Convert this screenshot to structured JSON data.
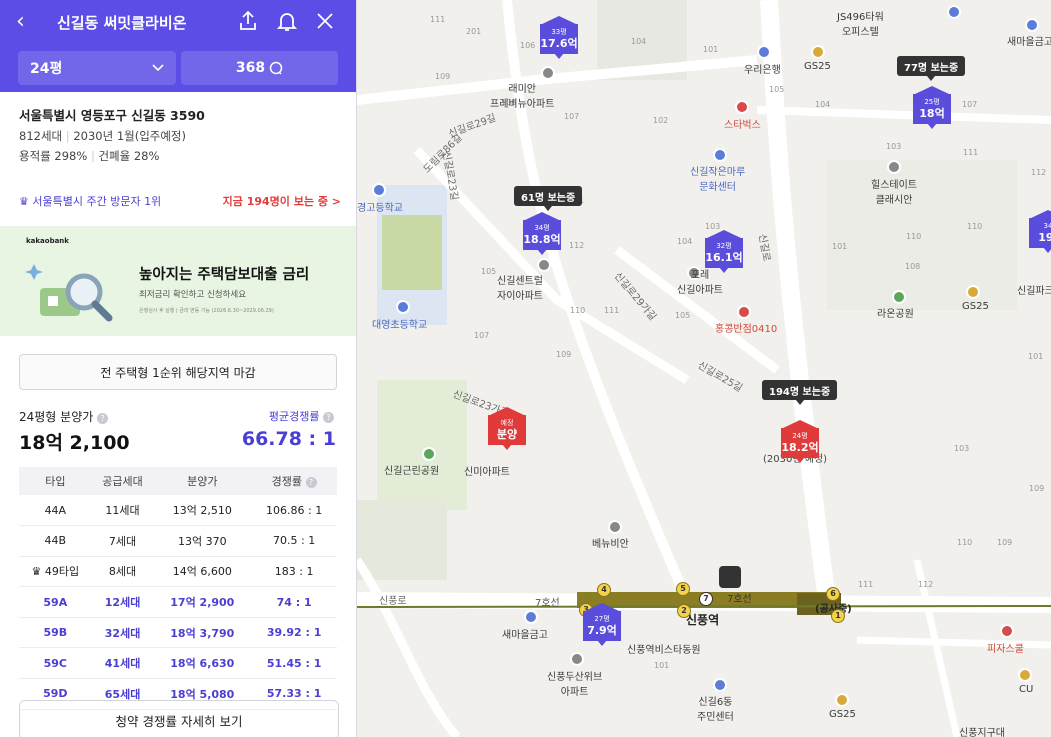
{
  "header": {
    "back_glyph": "‹",
    "title": "신길동 써밋클라비온",
    "size_select": "24평",
    "views": "368"
  },
  "info": {
    "address": "서울특별시 영등포구 신길동 3590",
    "households": "812세대",
    "move_in": "2030년 1월(입주예정)",
    "floor_area_ratio": "용적률 298%",
    "building_coverage": "건폐율 28%"
  },
  "rank": {
    "left": "서울특별시 주간 방문자 1위",
    "right": "지금 194명이 보는 중 >"
  },
  "banner": {
    "brand": "kakaobank",
    "headline": "높아지는 주택담보대출 금리",
    "sub": "최저금리 확인하고 신청하세요",
    "fine": "은행심사 후 실행 | 금리 변동 가능 (2026.6.30~2029.06.29)"
  },
  "close_button": "전 주택형 1순위 해당지역 마감",
  "price": {
    "label": "24평형 분양가",
    "value": "18억 2,100",
    "comp_label": "평균경쟁률",
    "comp_value": "66.78 : 1"
  },
  "table": {
    "headers": [
      "타입",
      "공급세대",
      "분양가",
      "경쟁률"
    ],
    "rows": [
      {
        "type": "44A",
        "units": "11세대",
        "price": "13억 2,510",
        "ratio": "106.86 : 1",
        "hl": false
      },
      {
        "type": "44B",
        "units": "7세대",
        "price": "13억 370",
        "ratio": "70.5 : 1",
        "hl": false
      },
      {
        "type": "♛ 49타입",
        "units": "8세대",
        "price": "14억 6,600",
        "ratio": "183 : 1",
        "hl": false
      },
      {
        "type": "59A",
        "units": "12세대",
        "price": "17억 2,900",
        "ratio": "74 : 1",
        "hl": true
      },
      {
        "type": "59B",
        "units": "32세대",
        "price": "18억 3,790",
        "ratio": "39.92 : 1",
        "hl": true
      },
      {
        "type": "59C",
        "units": "41세대",
        "price": "18억 6,630",
        "ratio": "51.45 : 1",
        "hl": true
      },
      {
        "type": "59D",
        "units": "65세대",
        "price": "18억 5,080",
        "ratio": "57.33 : 1",
        "hl": true
      }
    ]
  },
  "detail_button": "청약 경쟁률 자세히 보기",
  "map": {
    "markers": [
      {
        "size": "33평",
        "price": "17.6억",
        "color": "blue"
      },
      {
        "size": "34평",
        "price": "18.8억",
        "color": "blue"
      },
      {
        "size": "32평",
        "price": "16.1억",
        "color": "blue"
      },
      {
        "size": "25평",
        "price": "18억",
        "color": "blue"
      },
      {
        "size": "24평",
        "price": "18.2억",
        "color": "red"
      },
      {
        "size": "예정",
        "price": "분양",
        "color": "red"
      },
      {
        "size": "27평",
        "price": "7.9억",
        "color": "blue"
      },
      {
        "size": "34",
        "price": "19.",
        "color": "blue"
      }
    ],
    "bubbles": [
      "77명 보는중",
      "61명 보는중",
      "194명 보는중"
    ],
    "places": {
      "raemian": "래미안\n프레비뉴아파트",
      "woori": "우리은행",
      "gs25a": "GS25",
      "starbucks": "스타벅스",
      "singil_hall": "신길작은마루\n문화센터",
      "hillstate": "힐스테이트\n클래시안",
      "js496": "JS496타워\n오피스텔",
      "saemaeul1": "새마을금고",
      "center_park": "신길센트럴\n자이아파트",
      "pohang": "포레\n신길아파트",
      "hongkong": "홍콩반점0410",
      "raon": "라온공원",
      "gs25b": "GS25",
      "singil_park": "신길파크",
      "school1": "경고등학교",
      "school2": "대영초등학교",
      "singeun": "신길근린공원",
      "shinmi": "신미아파트",
      "bebibi": "베뉴비안",
      "singpung": "신풍역",
      "singpung_hall": "신풍역비스타동원",
      "saemaeul2": "새마을금고",
      "dusan": "신풍두산위브\n아파트",
      "singil6": "신길6동\n주민센터",
      "pizza": "피자스쿨",
      "cu": "CU",
      "gs25c": "GS25",
      "singil_gu": "신풍지구대",
      "sinpung_ro": "신풍로",
      "line7": "7호선",
      "line7b": "7호선",
      "under": "(공사중)",
      "obtained": "(2030년 예정)"
    }
  }
}
